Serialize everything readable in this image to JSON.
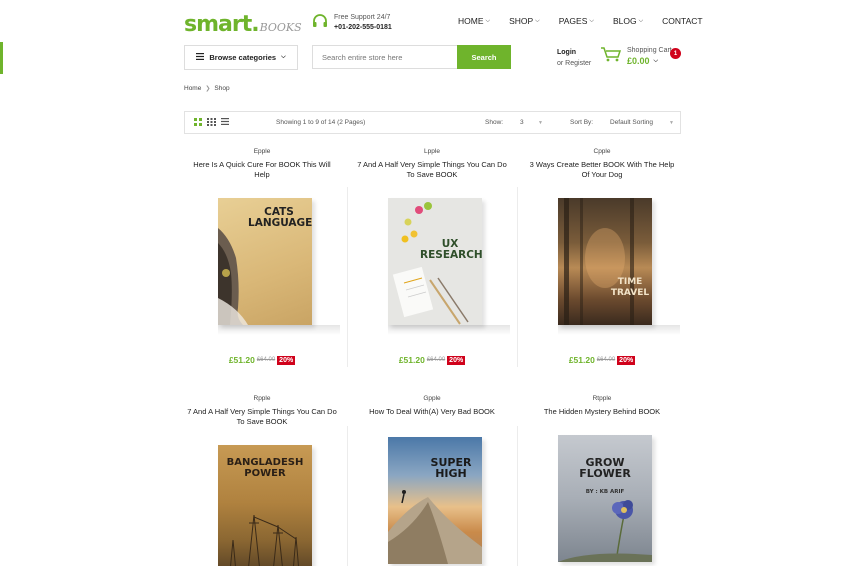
{
  "header": {
    "logo_main": "smart.",
    "logo_sub": "BOOKS",
    "support_label": "Free Support 24/7",
    "support_phone": "+01-202-555-0181",
    "nav": [
      {
        "label": "HOME",
        "has_caret": true
      },
      {
        "label": "SHOP",
        "has_caret": true
      },
      {
        "label": "PAGES",
        "has_caret": true
      },
      {
        "label": "BLOG",
        "has_caret": true
      },
      {
        "label": "CONTACT",
        "has_caret": false
      }
    ]
  },
  "search": {
    "browse_label": "Browse categories",
    "placeholder": "Search entire store here",
    "button_label": "Search"
  },
  "account": {
    "login": "Login",
    "register": "or Register"
  },
  "cart": {
    "label": "Shopping Cart",
    "total": "£0.00",
    "count": "1"
  },
  "breadcrumb": [
    "Home",
    "Shop"
  ],
  "toolbar": {
    "showing": "Showing 1 to 9 of 14 (2 Pages)",
    "show_label": "Show:",
    "show_value": "3",
    "sort_label": "Sort By:",
    "sort_value": "Default Sorting"
  },
  "products": [
    {
      "brand": "Epple",
      "title": "Here Is A Quick Cure For BOOK This Will Help",
      "price": "£51.20",
      "old_price": "£64.00",
      "discount": "20%",
      "cover_text": "CATS LANGUAGE"
    },
    {
      "brand": "Lpple",
      "title": "7 And A Half Very Simple Things You Can Do To Save BOOK",
      "price": "£51.20",
      "old_price": "£64.00",
      "discount": "20%",
      "cover_text": "UX RESEARCH"
    },
    {
      "brand": "Cpple",
      "title": "3 Ways Create Better BOOK With The Help Of Your Dog",
      "price": "£51.20",
      "old_price": "£64.00",
      "discount": "20%",
      "cover_text": "TIME TRAVEL"
    },
    {
      "brand": "Rpple",
      "title": "7 And A Half Very Simple Things You Can Do To Save BOOK",
      "cover_text": "BANGLADESH POWER"
    },
    {
      "brand": "Gpple",
      "title": "How To Deal With(A) Very Bad BOOK",
      "cover_text": "SUPER HIGH"
    },
    {
      "brand": "Rtpple",
      "title": "The Hidden Mystery Behind BOOK",
      "cover_text": "GROW FLOWER",
      "cover_subtext": "BY : KB ARIF"
    }
  ],
  "colors": {
    "accent": "#6fb42c",
    "badge": "#d0021b"
  }
}
